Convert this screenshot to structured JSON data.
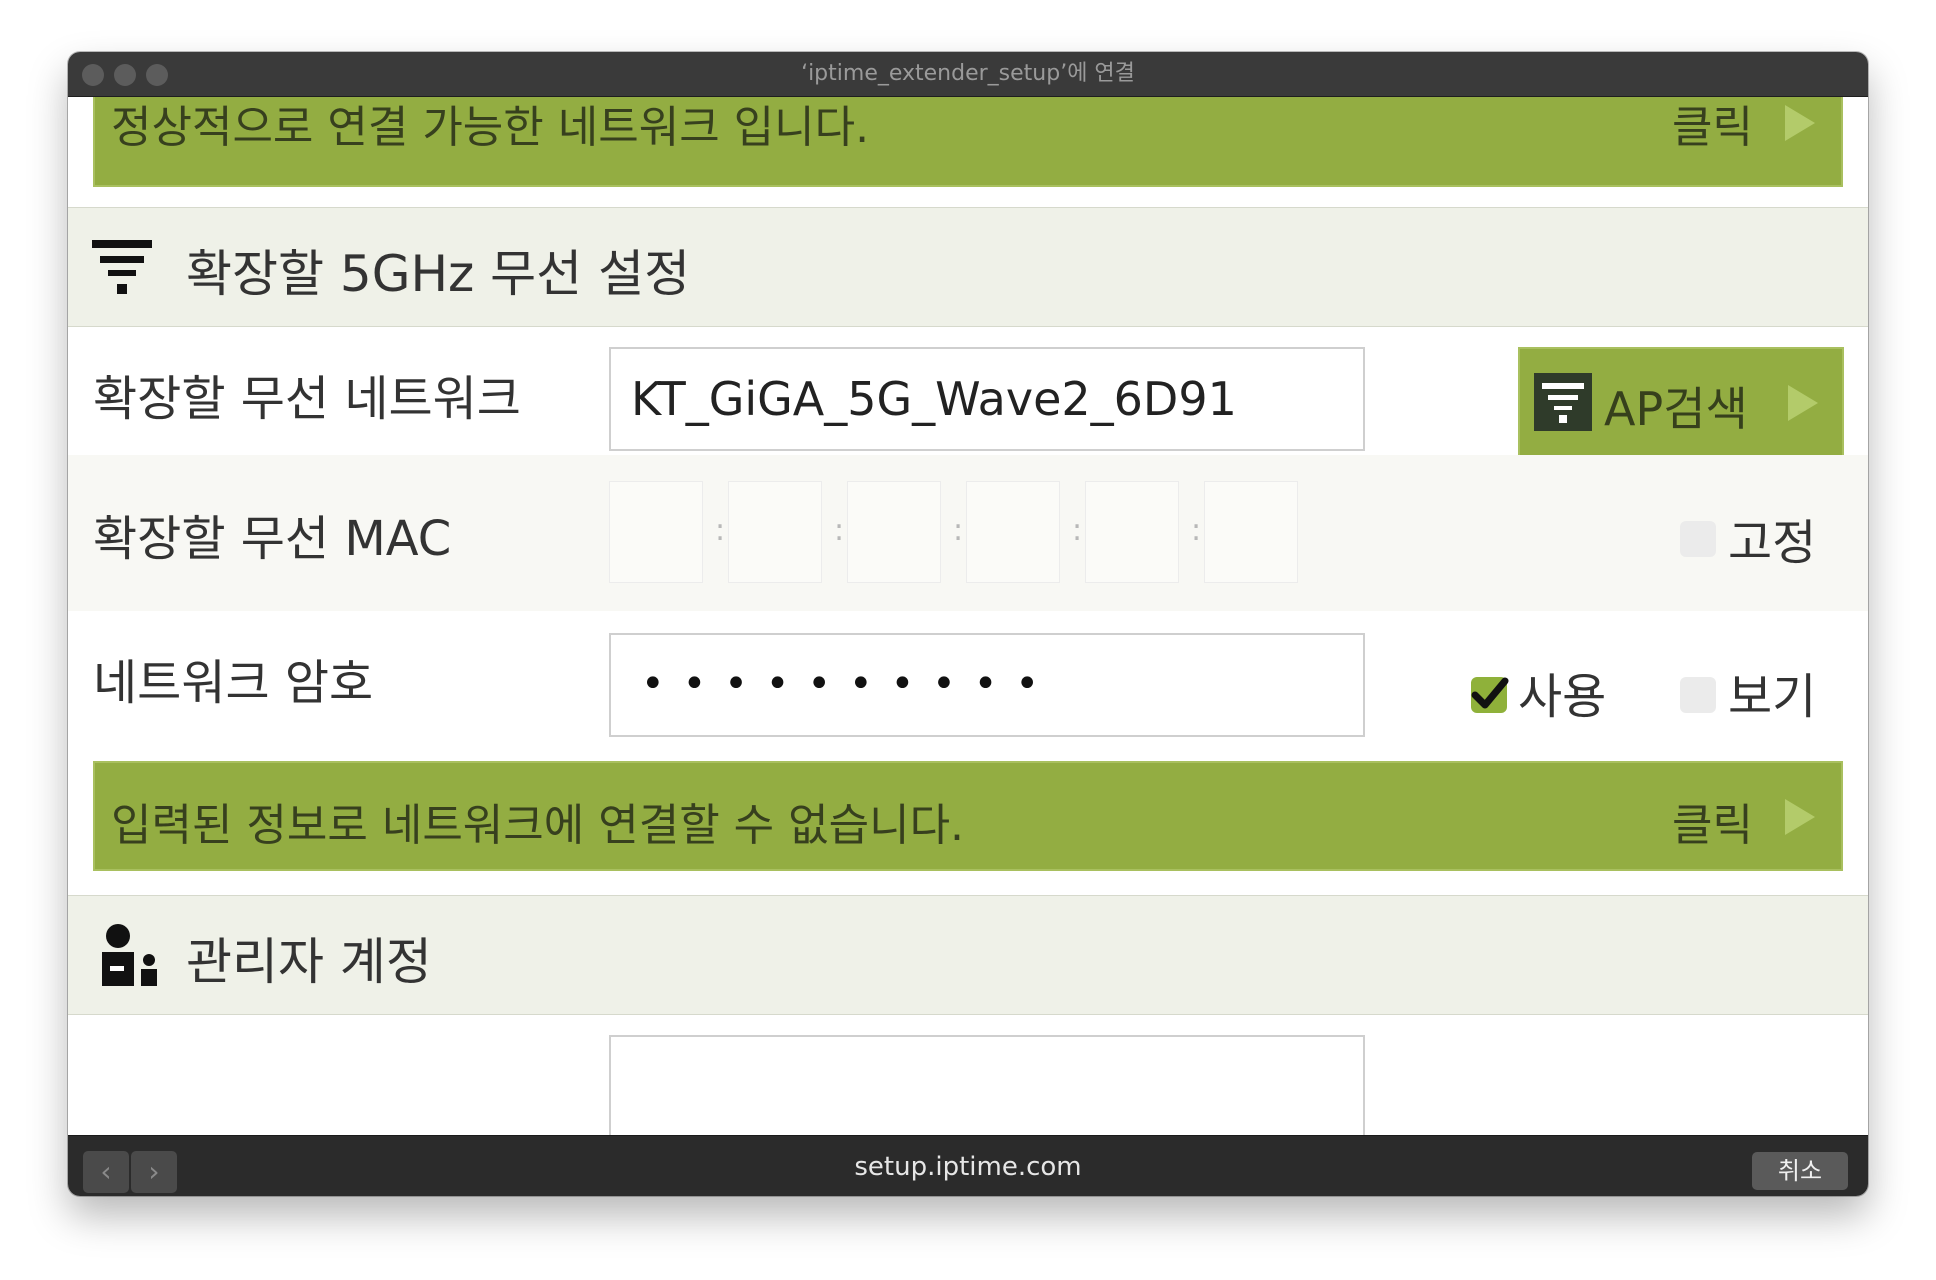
{
  "window": {
    "title": "‘iptime_extender_setup’에 연결"
  },
  "banners": {
    "top_text": "정상적으로 연결 가능한 네트워크 입니다.",
    "top_click": "클릭",
    "error_text": "입력된 정보로 네트워크에 연결할 수 없습니다.",
    "error_click": "클릭"
  },
  "wireless_section": {
    "title": "확장할 5GHz 무선 설정",
    "icon": "wifi-filter-icon"
  },
  "network_row": {
    "label": "확장할 무선 네트워크",
    "value": "KT_GiGA_5G_Wave2_6D91",
    "ap_search_label": "AP검색"
  },
  "mac_row": {
    "label": "확장할 무선 MAC",
    "separator": ":",
    "fixed_label": "고정",
    "fixed_checked": false
  },
  "password_row": {
    "label": "네트워크 암호",
    "value": "••••••••••",
    "use_label": "사용",
    "use_checked": true,
    "show_label": "보기",
    "show_checked": false
  },
  "admin_section": {
    "title": "관리자 계정",
    "icon": "admin-user-icon"
  },
  "bottom_bar": {
    "url": "setup.iptime.com",
    "cancel_label": "취소",
    "back_glyph": "‹",
    "forward_glyph": "›"
  },
  "colors": {
    "banner_green": "#93ad42",
    "section_bg": "#eff1e8",
    "ap_button_green": "#93ad42",
    "title_bar": "#3a3a3a"
  }
}
